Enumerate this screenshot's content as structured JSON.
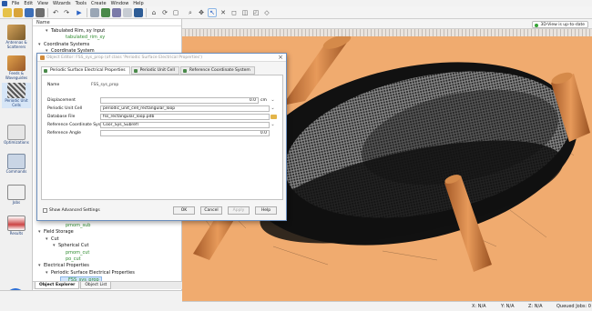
{
  "menu": [
    "File",
    "Edit",
    "View",
    "Wizards",
    "Tools",
    "Create",
    "Window",
    "Help"
  ],
  "sidebar": {
    "items": [
      {
        "label": "Antennas & Scatterers",
        "icon": "antenna-icon"
      },
      {
        "label": "Feeds & Waveguides",
        "icon": "feed-icon"
      },
      {
        "label": "Periodic Unit Cells",
        "icon": "unit-cell-icon"
      },
      {
        "label": "Optimizations",
        "icon": "optimization-icon"
      },
      {
        "label": "Commands",
        "icon": "commands-icon"
      },
      {
        "label": "Jobs",
        "icon": "jobs-icon"
      },
      {
        "label": "Results",
        "icon": "results-icon"
      }
    ],
    "run_icon": "play-icon"
  },
  "tree": {
    "header": "Name",
    "rows_top": [
      {
        "text": "Tabulated Rim, xy Input",
        "caret": "v",
        "indent": 1,
        "green": false
      },
      {
        "text": "tabulated_rim_xy",
        "caret": "",
        "indent": 3,
        "green": true
      },
      {
        "text": "Coordinate Systems",
        "caret": "v",
        "indent": 0,
        "green": false
      },
      {
        "text": "Coordinate System",
        "caret": "v",
        "indent": 1,
        "green": false
      }
    ],
    "rows_bottom": [
      {
        "text": "pmom_sub",
        "caret": "",
        "indent": 3,
        "green": true,
        "sel": false
      },
      {
        "text": "Field Storage",
        "caret": "v",
        "indent": 0,
        "green": false,
        "sel": false
      },
      {
        "text": "Cut",
        "caret": "v",
        "indent": 1,
        "green": false,
        "sel": false
      },
      {
        "text": "Spherical Cut",
        "caret": "v",
        "indent": 2,
        "green": false,
        "sel": false
      },
      {
        "text": "pmom_cut",
        "caret": "",
        "indent": 3,
        "green": true,
        "sel": false
      },
      {
        "text": "po_cut",
        "caret": "",
        "indent": 3,
        "green": true,
        "sel": false
      },
      {
        "text": "Electrical Properties",
        "caret": "v",
        "indent": 0,
        "green": false,
        "sel": false
      },
      {
        "text": "Periodic Surface Electrical Properties",
        "caret": "v",
        "indent": 1,
        "green": false,
        "sel": false
      },
      {
        "text": "FSS_sys_prop",
        "caret": "",
        "indent": 3,
        "green": true,
        "sel": true
      }
    ],
    "tabs": [
      "Object Explorer",
      "Object List"
    ]
  },
  "viewport": {
    "status": "3D-View is up-to-date",
    "colors": {
      "background": "#f0ab6f",
      "strut": "#c8743a",
      "mesh": "#3a3a3a"
    }
  },
  "dialog": {
    "title": "Object Editor: FSS_sys_prop (of class 'Periodic Surface Electrical Properties')",
    "tabs": [
      "Periodic Surface Electrical Properties",
      "Periodic Unit Cell",
      "Reference Coordinate System"
    ],
    "name_label": "Name",
    "name_value": "FSS_sys_prop",
    "fields": [
      {
        "label": "Displacement",
        "value": "0.0",
        "unit": "cm",
        "type": "number"
      },
      {
        "label": "Periodic Unit Cell",
        "value": "periodic_unit_cell_rectangular_loop",
        "unit": "",
        "type": "select"
      },
      {
        "label": "Database File",
        "value": "fss_rectangular_loop.pdb",
        "unit": "",
        "type": "file"
      },
      {
        "label": "Reference Coordinate System",
        "value": "Coor_Sys_Subrefl",
        "unit": "",
        "type": "select"
      },
      {
        "label": "Reference Angle",
        "value": "0.0",
        "unit": "",
        "type": "number"
      }
    ],
    "show_advanced": "Show Advanced Settings",
    "buttons": {
      "ok": "OK",
      "cancel": "Cancel",
      "apply": "Apply",
      "help": "Help"
    }
  },
  "statusbar": {
    "x": "X: N/A",
    "y": "Y: N/A",
    "z": "Z: N/A",
    "queued": "Queued Jobs: 0"
  }
}
